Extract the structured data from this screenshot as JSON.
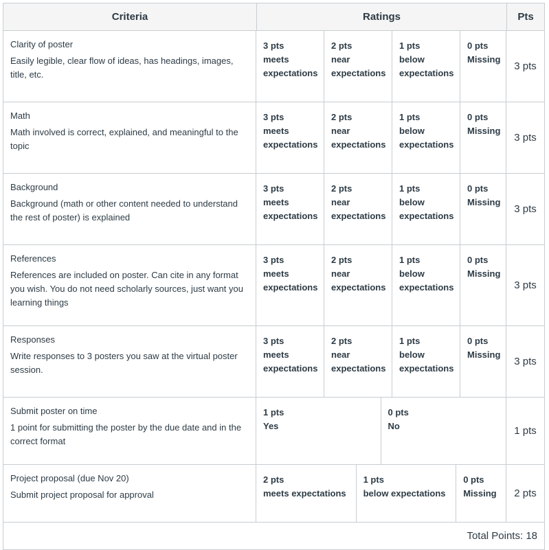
{
  "header": {
    "criteria": "Criteria",
    "ratings": "Ratings",
    "pts": "Pts"
  },
  "rows": [
    {
      "title": "Clarity of poster",
      "description": "Easily legible, clear flow of ideas, has headings, images, title, etc.",
      "ratings": [
        {
          "pts": "3 pts",
          "label": "meets expectations"
        },
        {
          "pts": "2 pts",
          "label": "near expectations"
        },
        {
          "pts": "1 pts",
          "label": "below expectations"
        },
        {
          "pts": "0 pts",
          "label": "Missing"
        }
      ],
      "points": "3 pts"
    },
    {
      "title": "Math",
      "description": "Math involved is correct, explained, and meaningful to the topic",
      "ratings": [
        {
          "pts": "3 pts",
          "label": "meets expectations"
        },
        {
          "pts": "2 pts",
          "label": "near expectations"
        },
        {
          "pts": "1 pts",
          "label": "below expectations"
        },
        {
          "pts": "0 pts",
          "label": "Missing"
        }
      ],
      "points": "3 pts"
    },
    {
      "title": "Background",
      "description": "Background (math or other content needed to understand the rest of poster) is explained",
      "ratings": [
        {
          "pts": "3 pts",
          "label": "meets expectations"
        },
        {
          "pts": "2 pts",
          "label": "near expectations"
        },
        {
          "pts": "1 pts",
          "label": "below expectations"
        },
        {
          "pts": "0 pts",
          "label": "Missing"
        }
      ],
      "points": "3 pts"
    },
    {
      "title": "References",
      "description": "References are included on poster. Can cite in any format you wish. You do not need scholarly sources, just want you learning things",
      "ratings": [
        {
          "pts": "3 pts",
          "label": "meets expectations"
        },
        {
          "pts": "2 pts",
          "label": "near expectations"
        },
        {
          "pts": "1 pts",
          "label": "below expectations"
        },
        {
          "pts": "0 pts",
          "label": "Missing"
        }
      ],
      "points": "3 pts"
    },
    {
      "title": "Responses",
      "description": "Write responses to 3 posters you saw at the virtual poster session.",
      "ratings": [
        {
          "pts": "3 pts",
          "label": "meets expectations"
        },
        {
          "pts": "2 pts",
          "label": "near expectations"
        },
        {
          "pts": "1 pts",
          "label": "below expectations"
        },
        {
          "pts": "0 pts",
          "label": "Missing"
        }
      ],
      "points": "3 pts"
    },
    {
      "title": "Submit poster on time",
      "description": "1 point for submitting the poster by the due date and in the correct format",
      "ratings": [
        {
          "pts": "1 pts",
          "label": "Yes"
        },
        {
          "pts": "0 pts",
          "label": "No"
        }
      ],
      "points": "1 pts"
    },
    {
      "title": "Project proposal (due Nov 20)",
      "description": "Submit project proposal for approval",
      "ratings": [
        {
          "pts": "2 pts",
          "label": "meets expectations"
        },
        {
          "pts": "1 pts",
          "label": "below expectations"
        },
        {
          "pts": "0 pts",
          "label": "Missing"
        }
      ],
      "points": "2 pts"
    }
  ],
  "total": "Total Points: 18"
}
